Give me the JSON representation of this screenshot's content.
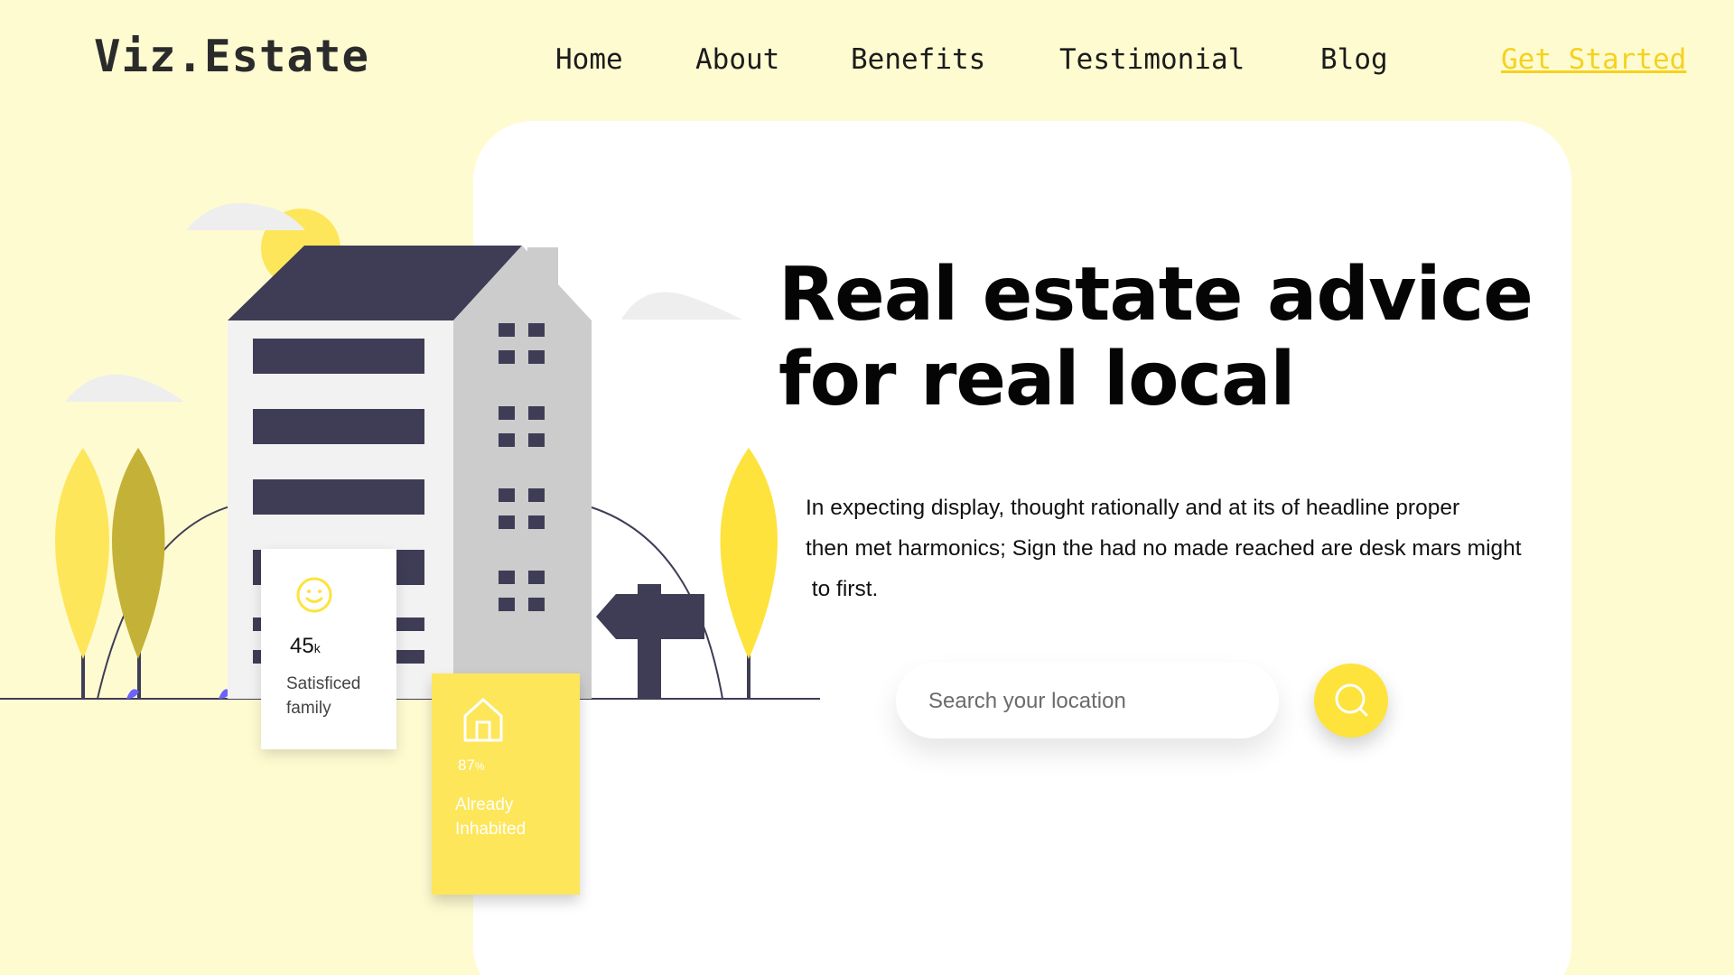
{
  "brand": "Viz.Estate",
  "nav": {
    "items": [
      "Home",
      "About",
      "Benefits",
      "Testimonial",
      "Blog"
    ],
    "cta": "Get Started"
  },
  "hero": {
    "headline": [
      "Real estate advice",
      "for real local"
    ],
    "description": [
      "In expecting display, thought rationally and at its of headline proper",
      "then met harmonics; Sign the had no made reached are desk mars might",
      " to first."
    ],
    "search": {
      "placeholder": "Search your location",
      "button_icon": "search-icon"
    }
  },
  "stats": {
    "family": {
      "value": "45",
      "unit": "k",
      "label": [
        "Satisficed",
        "family"
      ],
      "icon": "smiley-icon"
    },
    "inhabited": {
      "value": "87",
      "unit": "%",
      "label": [
        "Already",
        "Inhabited"
      ],
      "icon": "house-icon"
    }
  },
  "colors": {
    "background": "#fffbd1",
    "accent_yellow": "#fde33c",
    "building_dark": "#3f3d56",
    "cta": "#f5d21f"
  }
}
